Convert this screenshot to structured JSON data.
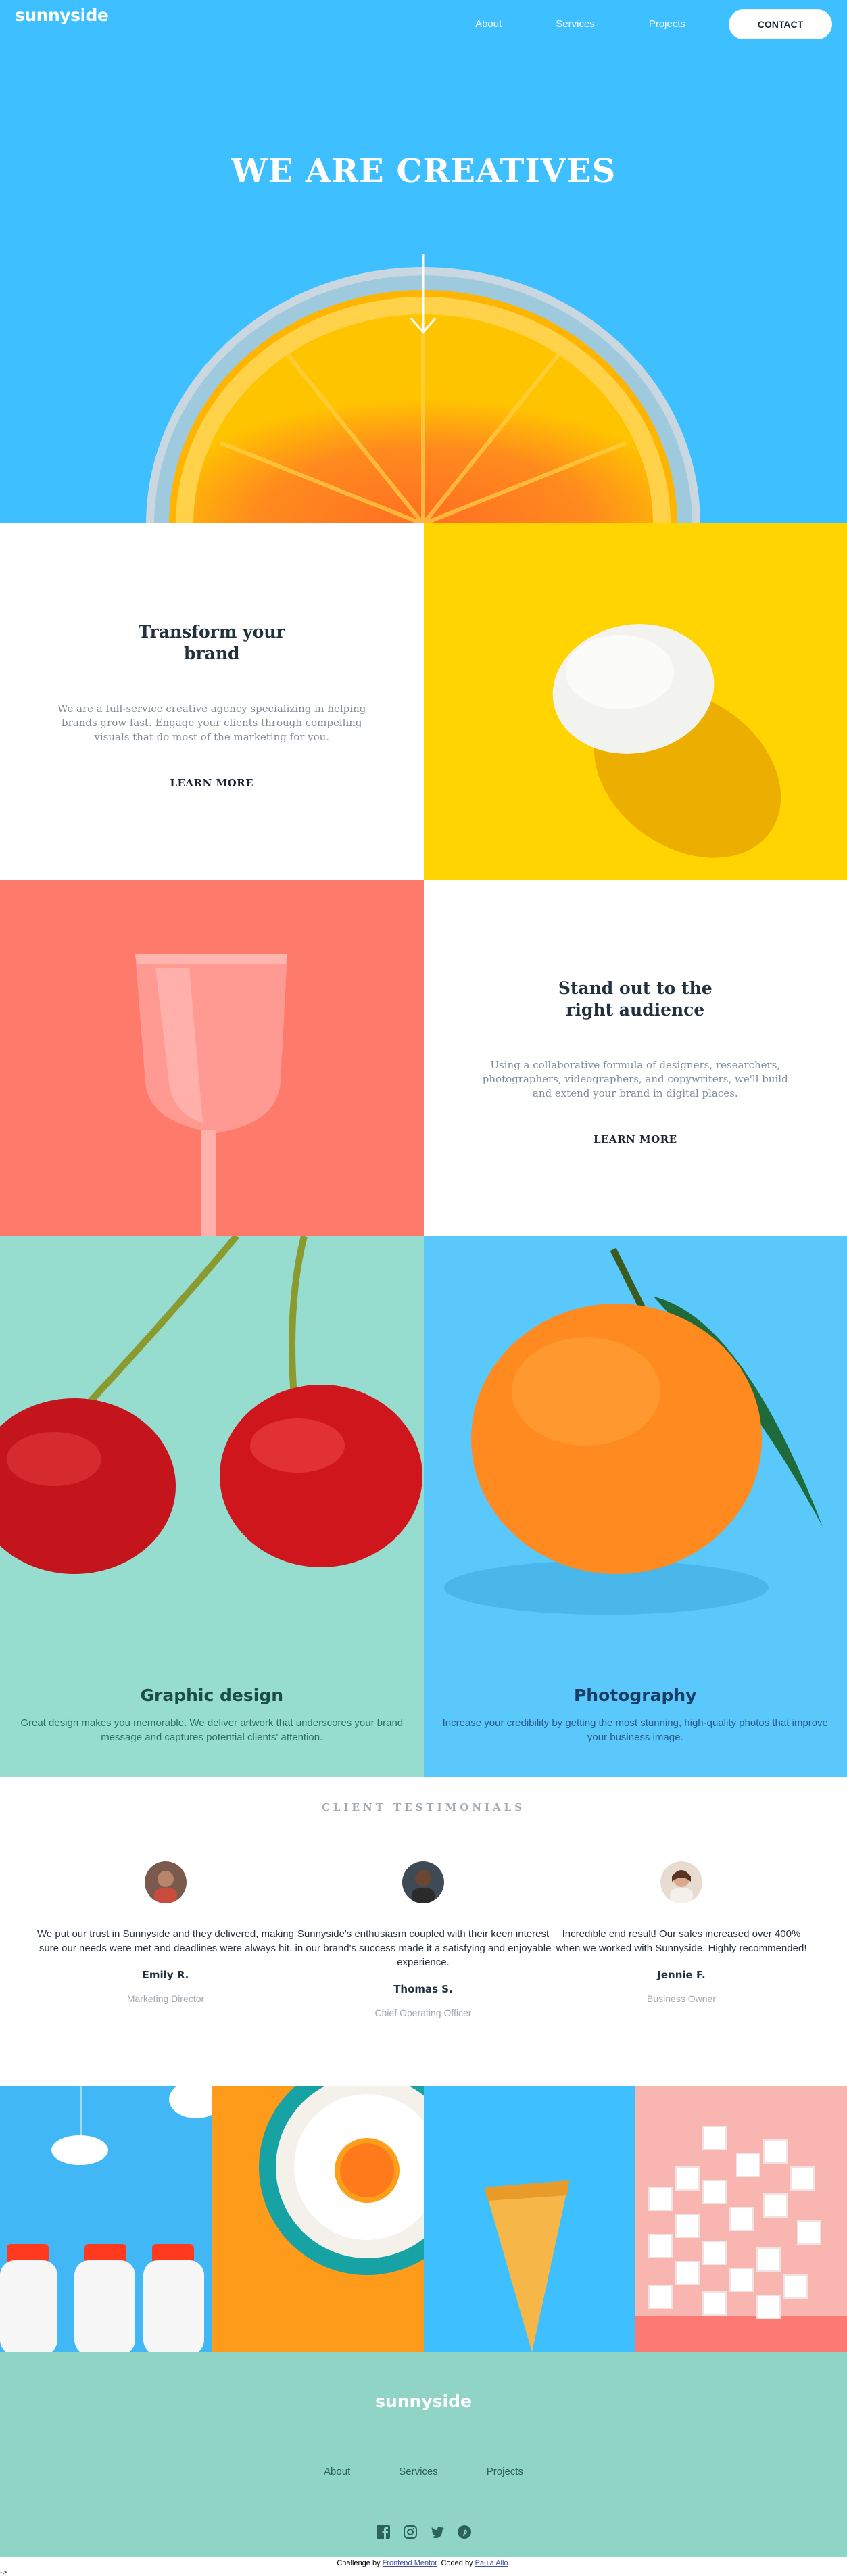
{
  "brand": {
    "logo": "sunnyside"
  },
  "nav": {
    "items": [
      "About",
      "Services",
      "Projects"
    ],
    "contact": "CONTACT"
  },
  "hero": {
    "title": "WE ARE CREATIVES"
  },
  "features": [
    {
      "title": "Transform your brand",
      "text": "We are a full-service creative agency specializing in helping brands grow fast. Engage your clients through compelling visuals that do most of the marketing for you.",
      "link": "LEARN MORE"
    },
    {
      "title": "Stand out to the right audience",
      "text": "Using a collaborative formula of designers, researchers, photographers, videographers, and copywriters, we'll build and extend your brand in digital places.",
      "link": "LEARN MORE"
    }
  ],
  "services": [
    {
      "title": "Graphic design",
      "text": "Great design makes you memorable. We deliver artwork that underscores your brand message and captures potential clients' attention."
    },
    {
      "title": "Photography",
      "text": "Increase your credibility by getting the most stunning, high-quality photos that improve your business image."
    }
  ],
  "testimonials": {
    "heading": "CLIENT TESTIMONIALS",
    "items": [
      {
        "quote": "We put our trust in Sunnyside and they delivered, making sure our needs were met and deadlines were always hit.",
        "name": "Emily R.",
        "role": "Marketing Director"
      },
      {
        "quote": "Sunnyside's enthusiasm coupled with their keen interest in our brand's success made it a satisfying and enjoyable experience.",
        "name": "Thomas S.",
        "role": "Chief Operating Officer"
      },
      {
        "quote": "Incredible end result! Our sales increased over 400% when we worked with Sunnyside. Highly recommended!",
        "name": "Jennie F.",
        "role": "Business Owner"
      }
    ]
  },
  "footer": {
    "logo": "sunnyside",
    "nav": [
      "About",
      "Services",
      "Projects"
    ],
    "social": [
      "facebook-icon",
      "instagram-icon",
      "twitter-icon",
      "pinterest-icon"
    ]
  },
  "attribution": {
    "prefix": "Challenge by ",
    "challenge_link": "Frontend Mentor",
    "middle": ". Coded by ",
    "author_link": "Paula Allo",
    "suffix": "."
  },
  "tail": "->"
}
